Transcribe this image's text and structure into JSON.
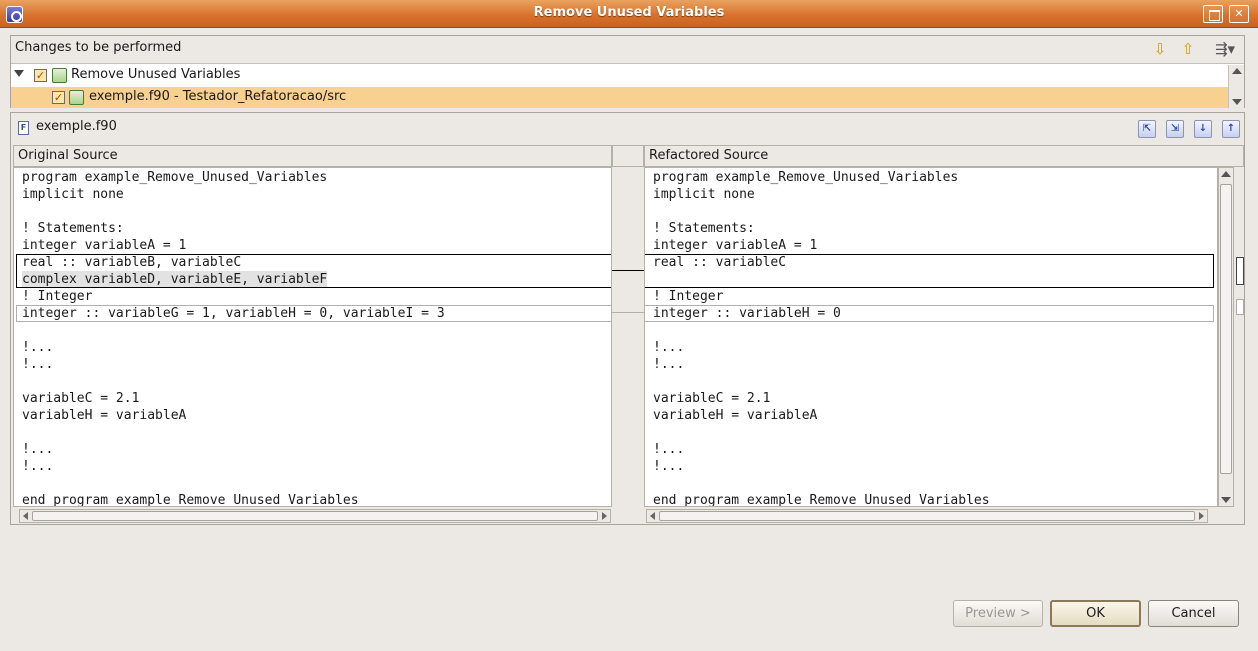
{
  "window": {
    "title": "Remove Unused Variables"
  },
  "changes": {
    "header": "Changes to be performed",
    "tree": [
      {
        "label": "Remove Unused Variables",
        "checked": true
      },
      {
        "label": "exemple.f90 - Testador_Refatoracao/src",
        "checked": true,
        "selected": true
      }
    ]
  },
  "compare": {
    "file_name": "exemple.f90",
    "left_header": "Original Source",
    "right_header": "Refactored Source",
    "left_lines": [
      "program example_Remove_Unused_Variables",
      "implicit none",
      "",
      "! Statements:",
      "integer variableA = 1",
      "real :: variableB, variableC",
      "complex variableD, variableE, variableF",
      "! Integer",
      "integer :: variableG = 1, variableH = 0, variableI = 3",
      "",
      "!...",
      "!...",
      "",
      "variableC = 2.1",
      "variableH = variableA",
      "",
      "!...",
      "!...",
      "",
      "end program example_Remove_Unused_Variables"
    ],
    "right_lines": [
      "program example_Remove_Unused_Variables",
      "implicit none",
      "",
      "! Statements:",
      "integer variableA = 1",
      "real :: variableC",
      "",
      "! Integer",
      "integer :: variableH = 0",
      "",
      "!...",
      "!...",
      "",
      "variableC = 2.1",
      "variableH = variableA",
      "",
      "!...",
      "!...",
      "",
      "end program example_Remove_Unused_Variables"
    ]
  },
  "buttons": {
    "preview": "Preview >",
    "ok": "OK",
    "cancel": "Cancel"
  },
  "colors": {
    "titlebar": "#d8732e",
    "selection": "#f8d090",
    "diff_highlight": "#e2e2e2"
  }
}
